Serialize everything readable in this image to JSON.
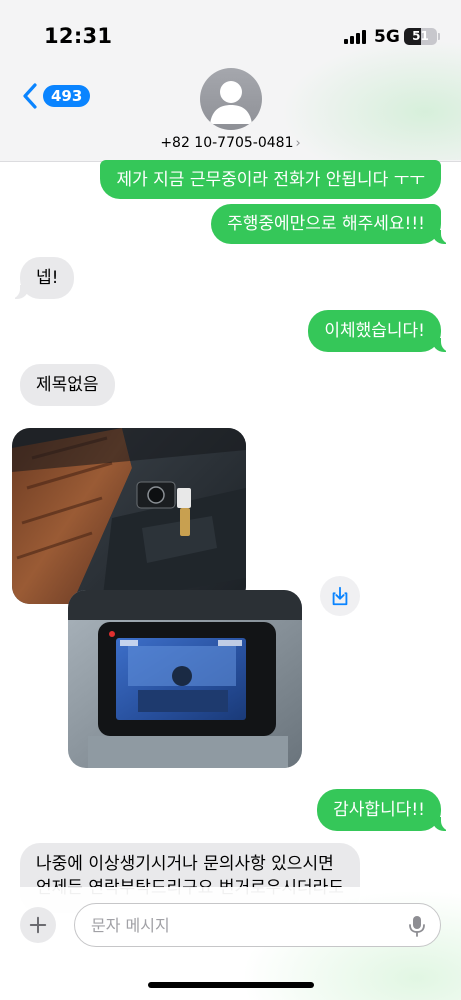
{
  "status_bar": {
    "time": "12:31",
    "network": "5G",
    "battery_level": "51"
  },
  "header": {
    "back_count": "493",
    "contact": "+82 10-7705-0481",
    "contact_chevron": "›"
  },
  "messages": [
    {
      "direction": "sent",
      "text": "제가 지금 근무중이라 전화가 안됩니다 ㅜㅜ"
    },
    {
      "direction": "sent",
      "text": "주행중에만으로 해주세요!!!"
    },
    {
      "direction": "received",
      "text": "넵!"
    },
    {
      "direction": "sent",
      "text": "이체했습니다!"
    },
    {
      "direction": "received",
      "text": "제목없음"
    },
    {
      "direction": "received",
      "type": "photo",
      "subject": "dashcam-mounted-on-windshield"
    },
    {
      "direction": "received",
      "type": "photo",
      "subject": "dashcam-screen-closeup"
    },
    {
      "direction": "sent",
      "text": "감사합니다!!"
    },
    {
      "direction": "received",
      "lines": [
        "나중에 이상생기시거나 문의사항 있으시면",
        "언제든 연락부탁드리구요 번거로우시더라도"
      ]
    }
  ],
  "input": {
    "placeholder": "문자 메시지"
  },
  "icons": {
    "back": "chevron-left-icon",
    "avatar": "person-icon",
    "save": "download-icon",
    "plus": "plus-icon",
    "mic": "microphone-icon"
  },
  "colors": {
    "sent_bubble": "#35c759",
    "received_bubble": "#e9e9eb",
    "accent": "#0a84ff"
  }
}
